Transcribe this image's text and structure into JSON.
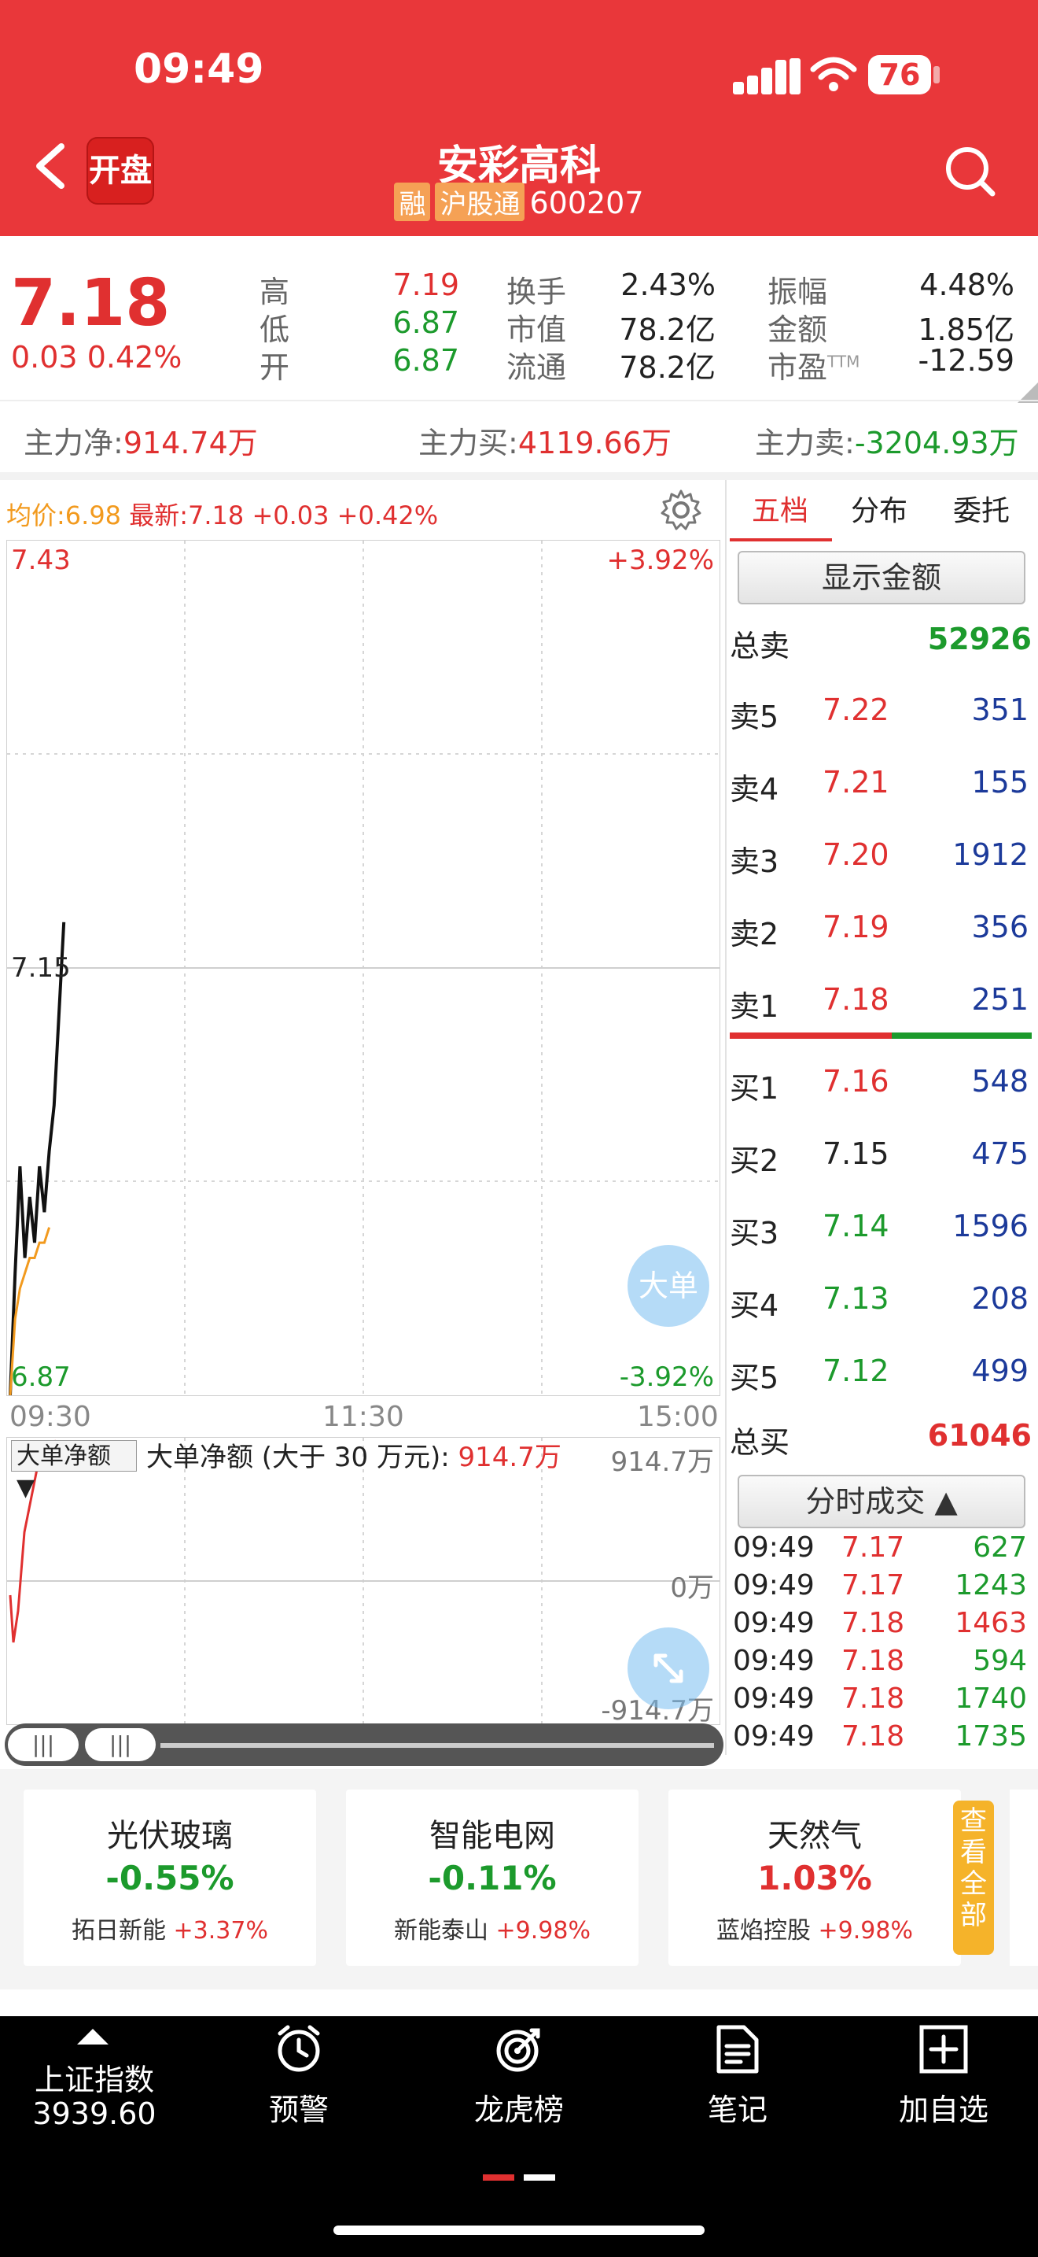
{
  "status_bar": {
    "time": "09:49",
    "battery": "76"
  },
  "header": {
    "logo_text": "开盘",
    "title": "安彩高科",
    "tag_rong": "融",
    "tag_hgt": "沪股通",
    "code": "600207"
  },
  "quote": {
    "price": "7.18",
    "change": "0.03 0.42%",
    "stats": [
      {
        "label": "高",
        "value": "7.19",
        "color": "#e03030"
      },
      {
        "label": "低",
        "value": "6.87",
        "color": "#1c9a2c"
      },
      {
        "label": "开",
        "value": "6.87",
        "color": "#1c9a2c"
      },
      {
        "label": "换手",
        "value": "2.43%"
      },
      {
        "label": "市值",
        "value": "78.2亿"
      },
      {
        "label": "流通",
        "value": "78.2亿"
      },
      {
        "label": "振幅",
        "value": "4.48%"
      },
      {
        "label": "金额",
        "value": "1.85亿"
      },
      {
        "label": "市盈",
        "sup": "TTM",
        "value": "-12.59"
      }
    ],
    "main_net_label": "主力净:",
    "main_net": "914.74万",
    "main_buy_label": "主力买:",
    "main_buy": "4119.66万",
    "main_sell_label": "主力卖:",
    "main_sell": "-3204.93万"
  },
  "chart": {
    "avg_label": "均价:6.98",
    "latest_label": "最新:7.18",
    "latest_change": "+0.03",
    "latest_pct": "+0.42%",
    "y_top": "7.43",
    "y_mid": "7.15",
    "y_bottom": "6.87",
    "pct_top": "+3.92%",
    "pct_bottom": "-3.92%",
    "x_start": "09:30",
    "x_mid": "11:30",
    "x_end": "15:00",
    "big_order_btn": "大单",
    "sub_select": "大单净额",
    "sub_title": "大单净额 (大于 30 万元):",
    "sub_value": "914.7万",
    "sub_top": "914.7万",
    "sub_mid": "0万",
    "sub_bottom": "-914.7万"
  },
  "chart_data": {
    "type": "line",
    "ylim": [
      6.87,
      7.43
    ],
    "series": [
      {
        "values": [
          6.87,
          6.95,
          7.02,
          6.96,
          7.0,
          6.97,
          7.02,
          6.99,
          7.03,
          7.06,
          7.12,
          7.18
        ]
      },
      {
        "values": [
          6.87,
          6.92,
          6.94,
          6.95,
          6.96,
          6.96,
          6.97,
          6.97,
          6.98
        ]
      }
    ]
  },
  "orderbook": {
    "tabs": [
      "五档",
      "分布",
      "委托"
    ],
    "show_amount_btn": "显示金额",
    "total_sell_label": "总卖",
    "total_sell": "52926",
    "sells": [
      {
        "label": "卖5",
        "price": "7.22",
        "vol": "351"
      },
      {
        "label": "卖4",
        "price": "7.21",
        "vol": "155"
      },
      {
        "label": "卖3",
        "price": "7.20",
        "vol": "1912"
      },
      {
        "label": "卖2",
        "price": "7.19",
        "vol": "356"
      },
      {
        "label": "卖1",
        "price": "7.18",
        "vol": "251"
      }
    ],
    "buys": [
      {
        "label": "买1",
        "price": "7.16",
        "vol": "548",
        "color": "#e03030"
      },
      {
        "label": "买2",
        "price": "7.15",
        "vol": "475",
        "color": "#222222"
      },
      {
        "label": "买3",
        "price": "7.14",
        "vol": "1596",
        "color": "#1c9a2c"
      },
      {
        "label": "买4",
        "price": "7.13",
        "vol": "208",
        "color": "#1c9a2c"
      },
      {
        "label": "买5",
        "price": "7.12",
        "vol": "499",
        "color": "#1c9a2c"
      }
    ],
    "total_buy_label": "总买",
    "total_buy": "61046",
    "trades_btn": "分时成交",
    "trades": [
      {
        "time": "09:49",
        "price": "7.17",
        "vol": "627",
        "color": "#1c9a2c"
      },
      {
        "time": "09:49",
        "price": "7.17",
        "vol": "1243",
        "color": "#1c9a2c"
      },
      {
        "time": "09:49",
        "price": "7.18",
        "vol": "1463",
        "color": "#e03030"
      },
      {
        "time": "09:49",
        "price": "7.18",
        "vol": "594",
        "color": "#1c9a2c"
      },
      {
        "time": "09:49",
        "price": "7.18",
        "vol": "1740",
        "color": "#1c9a2c"
      },
      {
        "time": "09:49",
        "price": "7.18",
        "vol": "1735",
        "color": "#1c9a2c"
      }
    ]
  },
  "sector_cards": [
    {
      "name": "光伏玻璃",
      "pct": "-0.55%",
      "stock": "拓日新能",
      "stock_pct": "+3.37%",
      "color": "#1c9a2c"
    },
    {
      "name": "智能电网",
      "pct": "-0.11%",
      "stock": "新能泰山",
      "stock_pct": "+9.98%",
      "color": "#1c9a2c"
    },
    {
      "name": "天然气",
      "pct": "1.03%",
      "stock": "蓝焰控股",
      "stock_pct": "+9.98%",
      "color": "#e03030"
    }
  ],
  "see_all": "查看全部",
  "bottom_nav": {
    "index_name": "上证指数",
    "index_value": "3939.60",
    "alert": "预警",
    "dragon": "龙虎榜",
    "notes": "笔记",
    "add_watch": "加自选"
  }
}
